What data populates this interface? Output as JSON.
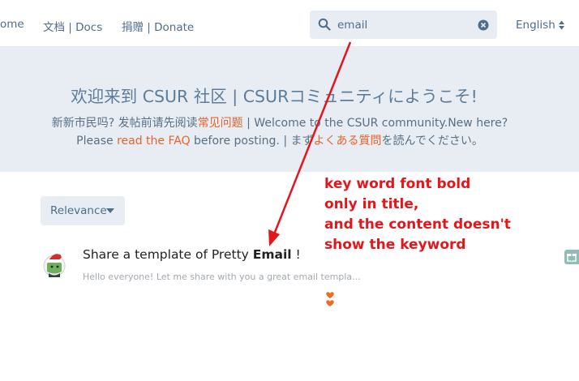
{
  "header": {
    "nav": [
      {
        "label": "ome"
      },
      {
        "label": "文档 | Docs"
      },
      {
        "label": "捐赠 | Donate"
      }
    ],
    "search": {
      "value": "email",
      "icon": "search-icon",
      "clear_icon": "clear-icon"
    },
    "language": {
      "label": "English",
      "icon": "sort-caret-icon"
    }
  },
  "hero": {
    "title": "欢迎来到 CSUR 社区 | CSURコミュニティにようこそ!",
    "line1_pre": "新新市民吗?  发帖前请先阅读",
    "line1_link": "常见问题",
    "line1_post": " | Welcome to the CSUR community.New here?",
    "line2_pre": "Please ",
    "line2_link": "read the FAQ",
    "line2_mid": " before posting. | まず",
    "line2_link2": "よくある質問",
    "line2_post": "を読んでください。"
  },
  "sort": {
    "label": "Relevance"
  },
  "results": [
    {
      "title_pre": "Share a template of Pretty ",
      "title_bold": "Email",
      "title_post": " !",
      "excerpt": "Hello everyone! Let me share with you a great email templa..."
    }
  ],
  "annotation": {
    "lines": [
      "key word font bold",
      "only in title,",
      "and the content doesn't",
      "show the keyword"
    ],
    "color": "#e3161c"
  },
  "colors": {
    "accent": "#e8632c",
    "nav_text": "#4f6d8a",
    "hero_bg": "#e7edf3"
  }
}
